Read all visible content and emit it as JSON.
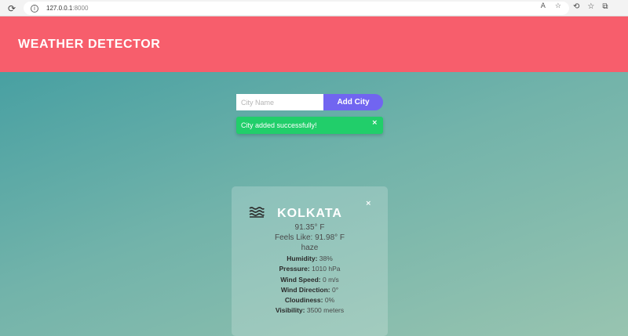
{
  "browser": {
    "url_host": "127.0.0.1",
    "url_port": ":8000"
  },
  "header": {
    "title": "WEATHER DETECTOR"
  },
  "search": {
    "placeholder": "City Name",
    "value": "",
    "button_label": "Add City"
  },
  "alert": {
    "message": "City added successfully!",
    "close_glyph": "×"
  },
  "card": {
    "close_glyph": "×",
    "city": "KOLKATA",
    "temperature": "91.35° F",
    "feels_like": "Feels Like: 91.98° F",
    "description": "haze",
    "icon": "haze-icon",
    "stats": [
      {
        "label": "Humidity:",
        "value": "38%"
      },
      {
        "label": "Pressure:",
        "value": "1010 hPa"
      },
      {
        "label": "Wind Speed:",
        "value": "0 m/s"
      },
      {
        "label": "Wind Direction:",
        "value": "0°"
      },
      {
        "label": "Cloudiness:",
        "value": "0%"
      },
      {
        "label": "Visibility:",
        "value": "3500 meters"
      }
    ]
  },
  "colors": {
    "header_bg": "#f75e6c",
    "button_bg": "#7165f0",
    "alert_bg": "#21ce6a",
    "gradient_start": "#48a0a2",
    "gradient_end": "#98c4b0"
  }
}
